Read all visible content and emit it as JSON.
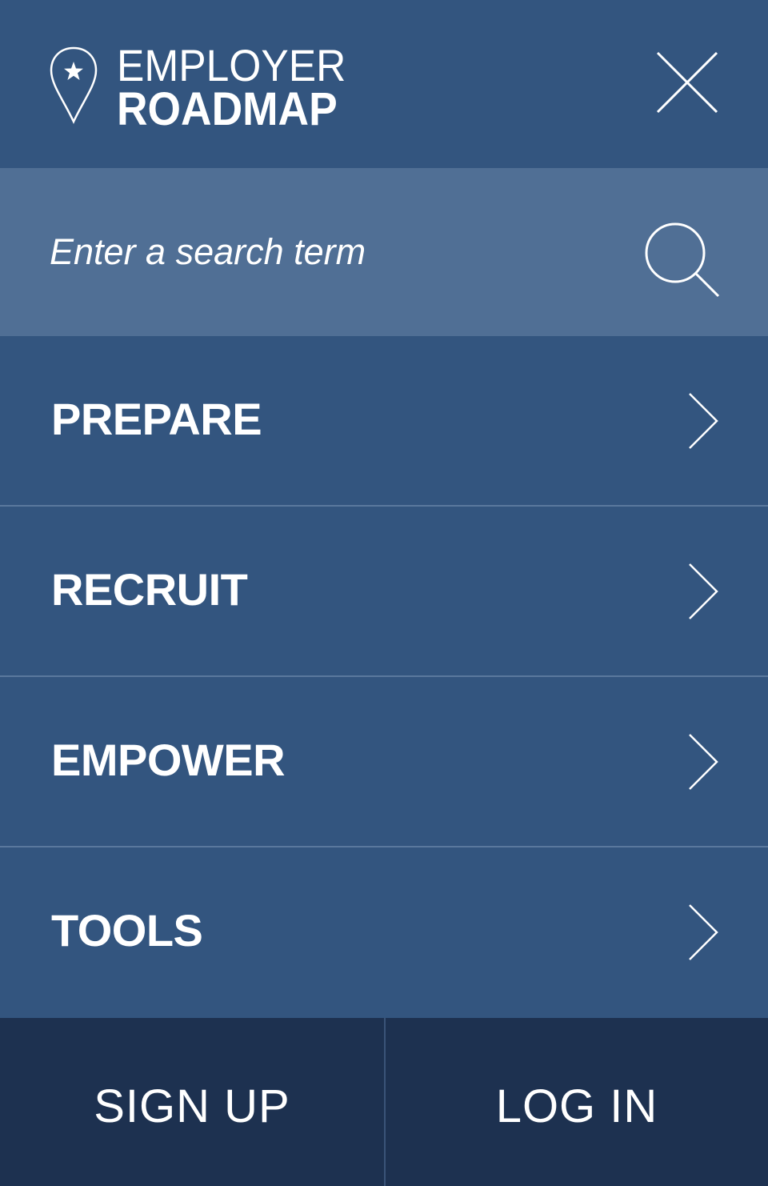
{
  "header": {
    "logo": {
      "line1": "EMPLOYER",
      "line2": "ROADMAP",
      "icon": "map-pin-star-icon"
    },
    "close_icon": "close-icon"
  },
  "search": {
    "placeholder": "Enter a search term",
    "value": "",
    "icon": "search-icon"
  },
  "nav": {
    "items": [
      {
        "label": "PREPARE",
        "icon": "chevron-right-icon"
      },
      {
        "label": "RECRUIT",
        "icon": "chevron-right-icon"
      },
      {
        "label": "EMPOWER",
        "icon": "chevron-right-icon"
      },
      {
        "label": "TOOLS",
        "icon": "chevron-right-icon"
      }
    ]
  },
  "footer": {
    "signup_label": "SIGN UP",
    "login_label": "LOG IN"
  },
  "colors": {
    "background": "#33557f",
    "search_background": "#506f95",
    "footer_background": "#1d3150",
    "divider": "#5a789d",
    "text": "#ffffff"
  }
}
